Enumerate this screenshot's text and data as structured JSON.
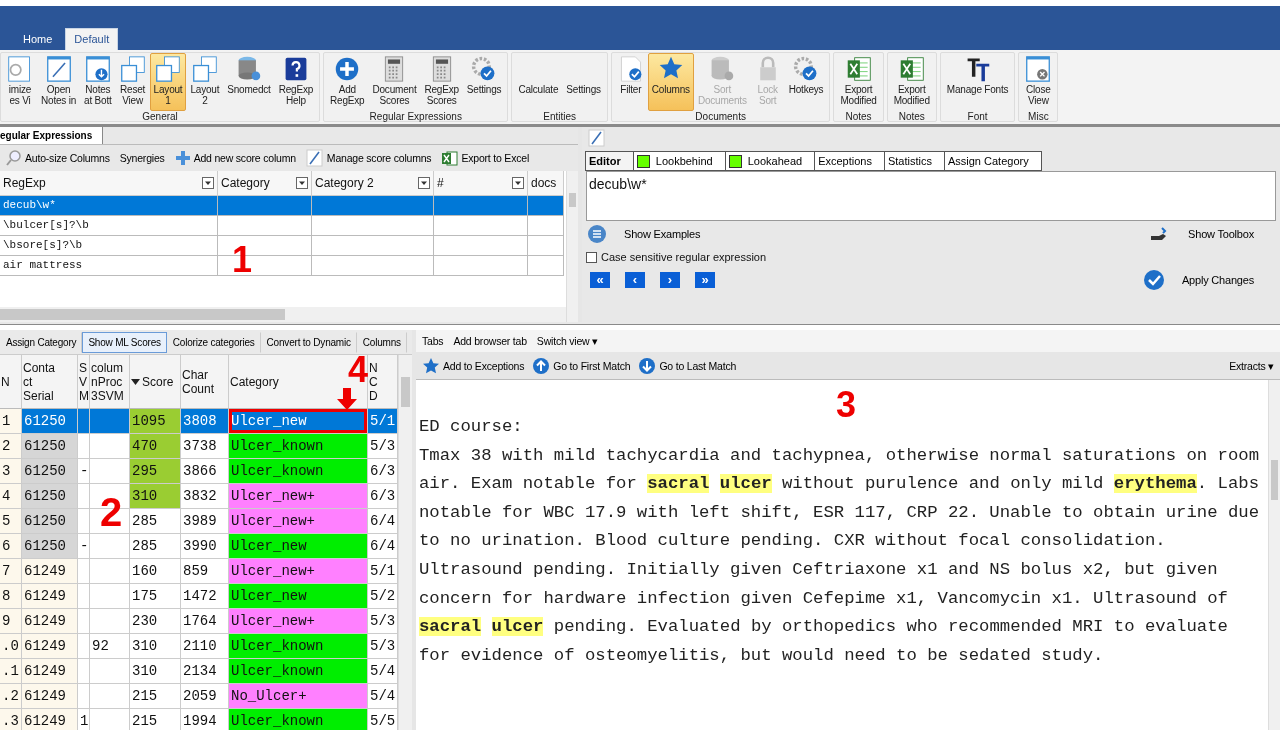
{
  "title_bar": {
    "tabs": [
      {
        "label": "Home",
        "selected": false
      },
      {
        "label": "Default",
        "selected": true
      }
    ]
  },
  "ribbon": {
    "groups": [
      {
        "label": "General",
        "items": [
          {
            "label": "imize\nes Vi",
            "kind": "search",
            "selected": false,
            "disabled": false
          },
          {
            "label": "Open\nNotes in",
            "kind": "pencil-window",
            "selected": false,
            "disabled": false
          },
          {
            "label": "Notes\nat Bott",
            "kind": "down-window",
            "selected": false,
            "disabled": false
          },
          {
            "label": "Reset\nView",
            "kind": "windows",
            "selected": false,
            "disabled": false
          },
          {
            "label": "Layout\n1",
            "kind": "windows",
            "selected": true,
            "disabled": false
          },
          {
            "label": "Layout\n2",
            "kind": "windows",
            "selected": false,
            "disabled": false
          },
          {
            "label": "Snomedct",
            "kind": "database",
            "selected": false,
            "disabled": false
          },
          {
            "label": "RegExp\nHelp",
            "kind": "help",
            "selected": false,
            "disabled": false
          }
        ]
      },
      {
        "label": "Regular Expressions",
        "items": [
          {
            "label": "Add\nRegExp",
            "kind": "plus",
            "selected": false,
            "disabled": false
          },
          {
            "label": "Document\nScores",
            "kind": "calculator",
            "selected": false,
            "disabled": false
          },
          {
            "label": "RegExp\nScores",
            "kind": "calculator",
            "selected": false,
            "disabled": false
          },
          {
            "label": "Settings",
            "kind": "gear",
            "selected": false,
            "disabled": false
          }
        ]
      },
      {
        "label": "Entities",
        "items": [
          {
            "label": "Calculate",
            "kind": "text",
            "selected": false,
            "disabled": false
          },
          {
            "label": "Settings",
            "kind": "text",
            "selected": false,
            "disabled": false
          }
        ]
      },
      {
        "label": "Documents",
        "items": [
          {
            "label": "Filter",
            "kind": "filter",
            "selected": false,
            "disabled": false
          },
          {
            "label": "Columns",
            "kind": "star",
            "selected": true,
            "disabled": false
          },
          {
            "label": "Sort\nDocuments",
            "kind": "database",
            "selected": false,
            "disabled": true
          },
          {
            "label": "Lock\nSort",
            "kind": "lock",
            "selected": false,
            "disabled": true
          },
          {
            "label": "Hotkeys",
            "kind": "gear",
            "selected": false,
            "disabled": false
          }
        ]
      },
      {
        "label": "Notes",
        "items": [
          {
            "label": "Export\nModified",
            "kind": "excel",
            "selected": false,
            "disabled": false
          }
        ]
      },
      {
        "label": "Notes",
        "items": [
          {
            "label": "Export\nModified",
            "kind": "excel",
            "selected": false,
            "disabled": false
          }
        ]
      },
      {
        "label": "Font",
        "items": [
          {
            "label": "Manage Fonts",
            "kind": "fonts",
            "selected": false,
            "disabled": false
          }
        ]
      },
      {
        "label": "Misc",
        "items": [
          {
            "label": "Close\nView",
            "kind": "close-window",
            "selected": false,
            "disabled": false
          }
        ]
      }
    ]
  },
  "regex_panel": {
    "tab": "egular Expressions",
    "annotation": "1",
    "toolbar": [
      {
        "label": "Auto-size Columns",
        "kind": "search"
      },
      {
        "label": "Synergies",
        "kind": "text"
      },
      {
        "label": "Add new score column",
        "kind": "plus"
      },
      {
        "label": "Manage score columns",
        "kind": "pencil"
      },
      {
        "label": "Export to Excel",
        "kind": "excel"
      }
    ],
    "columns": [
      "RegExp",
      "Category",
      "Category 2",
      "#",
      "docs"
    ],
    "rows": [
      {
        "regexp": "decub\\w*",
        "selected": true
      },
      {
        "regexp": "\\bulcer[s]?\\b",
        "selected": false
      },
      {
        "regexp": "\\bsore[s]?\\b",
        "selected": false
      },
      {
        "regexp": "air mattress",
        "selected": false
      }
    ]
  },
  "editor_panel": {
    "tabs": [
      {
        "label": "Editor",
        "selected": true
      },
      {
        "label": "Lookbehind",
        "selected": false,
        "color": "#66ff00"
      },
      {
        "label": "Lookahead",
        "selected": false,
        "color": "#66ff00"
      },
      {
        "label": "Exceptions",
        "selected": false
      },
      {
        "label": "Statistics",
        "selected": false
      },
      {
        "label": "Assign Category",
        "selected": false
      }
    ],
    "value": "decub\\w*",
    "show_examples": "Show Examples",
    "show_toolbox": "Show Toolbox",
    "case_sensitive": {
      "label": "Case sensitive regular expression",
      "checked": false
    },
    "nav": [
      "«",
      "‹",
      "›",
      "»"
    ],
    "apply": "Apply Changes"
  },
  "documents_panel": {
    "annotation": "2",
    "marker": "4",
    "toolbar": [
      {
        "label": "Assign Category",
        "selected": false
      },
      {
        "label": "Show ML Scores",
        "selected": true
      },
      {
        "label": "Colorize categories",
        "selected": false
      },
      {
        "label": "Convert to Dynamic",
        "selected": false
      },
      {
        "label": "Columns",
        "selected": false
      }
    ],
    "columns": [
      "N",
      "Conta\nct\nSerial",
      "S\nV\nM",
      "colum\nnProc\n3SVM",
      "Score",
      "Char\nCount",
      "Category",
      "N\nC\nD"
    ],
    "rows": [
      {
        "n": "1",
        "serial": {
          "text": "61250"
        },
        "score": {
          "text": "1095",
          "color": "#9acd32"
        },
        "chars": "3808",
        "category": {
          "text": "Ulcer_new"
        },
        "date": "5/1",
        "selected": true,
        "outlined": true
      },
      {
        "n": "2",
        "serial": {
          "text": "61250",
          "color": "#d6d6d6"
        },
        "score": {
          "text": "470",
          "color": "#9acd32"
        },
        "chars": "3738",
        "category": {
          "text": "Ulcer_known",
          "color": "#00ee00"
        },
        "date": "5/3",
        "selected": false,
        "outlined": false
      },
      {
        "n": "3",
        "serial": {
          "text": "61250",
          "color": "#d6d6d6"
        },
        "s": "-",
        "score": {
          "text": "295",
          "color": "#9acd32"
        },
        "chars": "3866",
        "category": {
          "text": "Ulcer_known",
          "color": "#00ee00"
        },
        "date": "6/3",
        "selected": false,
        "outlined": false
      },
      {
        "n": "4",
        "serial": {
          "text": "61250",
          "color": "#d6d6d6"
        },
        "score": {
          "text": "310",
          "color": "#9acd32"
        },
        "chars": "3832",
        "category": {
          "text": "Ulcer_new+",
          "color": "#ff80ff"
        },
        "date": "6/3",
        "selected": false,
        "outlined": false
      },
      {
        "n": "5",
        "serial": {
          "text": "61250",
          "color": "#d6d6d6"
        },
        "score": {
          "text": "285"
        },
        "chars": "3989",
        "category": {
          "text": "Ulcer_new+",
          "color": "#ff80ff"
        },
        "date": "6/4",
        "selected": false,
        "outlined": false
      },
      {
        "n": "6",
        "serial": {
          "text": "61250",
          "color": "#d6d6d6"
        },
        "s": "-",
        "score": {
          "text": "285"
        },
        "chars": "3990",
        "category": {
          "text": "Ulcer_new",
          "color": "#00ee00"
        },
        "date": "6/4",
        "selected": false,
        "outlined": false
      },
      {
        "n": "7",
        "serial": {
          "text": "61249",
          "color": "#fdf8ec"
        },
        "score": {
          "text": "160"
        },
        "chars": "859",
        "category": {
          "text": "Ulcer_new+",
          "color": "#ff80ff"
        },
        "date": "5/1",
        "selected": false,
        "outlined": false
      },
      {
        "n": "8",
        "serial": {
          "text": "61249",
          "color": "#fdf8ec"
        },
        "score": {
          "text": "175"
        },
        "chars": "1472",
        "category": {
          "text": "Ulcer_new",
          "color": "#00ee00"
        },
        "date": "5/2",
        "selected": false,
        "outlined": false
      },
      {
        "n": "9",
        "serial": {
          "text": "61249",
          "color": "#fdf8ec"
        },
        "score": {
          "text": "230"
        },
        "chars": "1764",
        "category": {
          "text": "Ulcer_new+",
          "color": "#ff80ff"
        },
        "date": "5/3",
        "selected": false,
        "outlined": false
      },
      {
        "n": ".0",
        "serial": {
          "text": "61249",
          "color": "#fdf8ec"
        },
        "proc": "92",
        "score": {
          "text": "310"
        },
        "chars": "2110",
        "category": {
          "text": "Ulcer_known",
          "color": "#00ee00"
        },
        "date": "5/3",
        "selected": false,
        "outlined": false
      },
      {
        "n": ".1",
        "serial": {
          "text": "61249",
          "color": "#fdf8ec"
        },
        "score": {
          "text": "310"
        },
        "chars": "2134",
        "category": {
          "text": "Ulcer_known",
          "color": "#00ee00"
        },
        "date": "5/4",
        "selected": false,
        "outlined": false
      },
      {
        "n": ".2",
        "serial": {
          "text": "61249",
          "color": "#fdf8ec"
        },
        "score": {
          "text": "215"
        },
        "chars": "2059",
        "category": {
          "text": "No_Ulcer+",
          "color": "#ff80ff"
        },
        "date": "5/4",
        "selected": false,
        "outlined": false
      },
      {
        "n": ".3",
        "serial": {
          "text": "61249",
          "color": "#fdf8ec"
        },
        "s": "1",
        "score": {
          "text": "215"
        },
        "chars": "1994",
        "category": {
          "text": "Ulcer_known",
          "color": "#00ee00"
        },
        "date": "5/5",
        "selected": false,
        "outlined": false
      }
    ]
  },
  "note_panel": {
    "annotation": "3",
    "menu": [
      "Tabs",
      "Add browser tab",
      "Switch view ▾"
    ],
    "toolbar": [
      {
        "label": "Add to Exceptions",
        "kind": "star"
      },
      {
        "label": "Go to First Match",
        "kind": "up"
      },
      {
        "label": "Go to Last Match",
        "kind": "down"
      }
    ],
    "extracts": "Extracts ▾",
    "heading": "ED course:",
    "text": "Tmax 38 with mild tachycardia and tachypnea, otherwise normal saturations on room air. Exam notable for **sacral** **ulcer** without purulence and only mild **erythema**. Labs notable for WBC 17.9 with left shift, ESR 117, CRP 22. Unable to obtain urine due to no urination. Blood culture pending. CXR without focal consolidation. Ultrasound pending. Initially given Ceftriaxone x1 and NS bolus x2, but given concern for hardware infection given Cefepime x1, Vancomycin x1. Ultrasound of **sacral** **ulcer** pending. Evaluated by orthopedics who recommended MRI to evaluate for evidence of osteomyelitis, but would need to be sedated study."
  }
}
